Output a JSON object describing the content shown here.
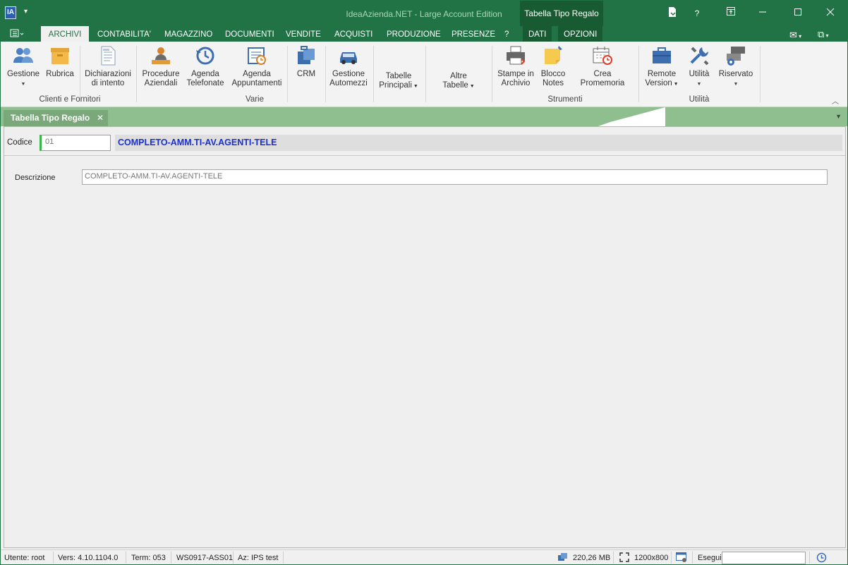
{
  "window": {
    "title": "IdeaAzienda.NET - Large Account Edition",
    "context_tab_title": "Tabella Tipo Regalo",
    "help_label": "?"
  },
  "ribbon_tabs": [
    {
      "label": "ARCHIVI"
    },
    {
      "label": "CONTABILITA'"
    },
    {
      "label": "MAGAZZINO"
    },
    {
      "label": "DOCUMENTI"
    },
    {
      "label": "VENDITE"
    },
    {
      "label": "ACQUISTI"
    },
    {
      "label": "PRODUZIONE"
    },
    {
      "label": "PRESENZE"
    },
    {
      "label": "?"
    },
    {
      "label": "DATI"
    },
    {
      "label": "OPZIONI"
    }
  ],
  "ribbon": {
    "buttons": {
      "gestione": {
        "line1": "Gestione",
        "line2": ""
      },
      "rubrica": {
        "line1": "Rubrica",
        "line2": ""
      },
      "dichiarazioni": {
        "line1": "Dichiarazioni",
        "line2": "di intento"
      },
      "procedure": {
        "line1": "Procedure",
        "line2": "Aziendali"
      },
      "agenda_tel": {
        "line1": "Agenda",
        "line2": "Telefonate"
      },
      "agenda_app": {
        "line1": "Agenda",
        "line2": "Appuntamenti"
      },
      "crm": {
        "line1": "CRM",
        "line2": ""
      },
      "automezzi": {
        "line1": "Gestione",
        "line2": "Automezzi"
      },
      "tabelle_principali": {
        "line1": "Tabelle",
        "line2": "Principali"
      },
      "altre_tabelle": {
        "line1": "Altre",
        "line2": "Tabelle"
      },
      "stampe": {
        "line1": "Stampe in",
        "line2": "Archivio"
      },
      "blocco": {
        "line1": "Blocco",
        "line2": "Notes"
      },
      "promemoria": {
        "line1": "Crea Promemoria",
        "line2": ""
      },
      "remote": {
        "line1": "Remote",
        "line2": "Version"
      },
      "utilita": {
        "line1": "Utilità",
        "line2": ""
      },
      "riservato": {
        "line1": "Riservato",
        "line2": ""
      }
    },
    "groups": {
      "clienti": "Clienti e Fornitori",
      "varie": "Varie",
      "strumenti": "Strumenti",
      "utilita": "Utilità"
    }
  },
  "doc_tab": {
    "label": "Tabella Tipo Regalo",
    "close": "✕"
  },
  "form": {
    "codice_label": "Codice",
    "codice_value": "01",
    "codice_description": "COMPLETO-AMM.TI-AV.AGENTI-TELE",
    "descrizione_label": "Descrizione",
    "descrizione_value": "COMPLETO-AMM.TI-AV.AGENTI-TELE"
  },
  "status_bar": {
    "utente": "Utente: root",
    "versione": "Vers: 4.10.1104.0",
    "term": "Term: 053",
    "workstation": "WS0917-ASS01",
    "azienda": "Az: IPS test",
    "memory": "220,26 MB",
    "resolution": "1200x800",
    "esegui_label": "Esegui"
  },
  "colors": {
    "title_bar": "#217346",
    "context_tab": "#185a32",
    "doc_strip": "#8fbf8f",
    "code_text": "#1a2fd0",
    "active_indicator": "#39b54a"
  }
}
